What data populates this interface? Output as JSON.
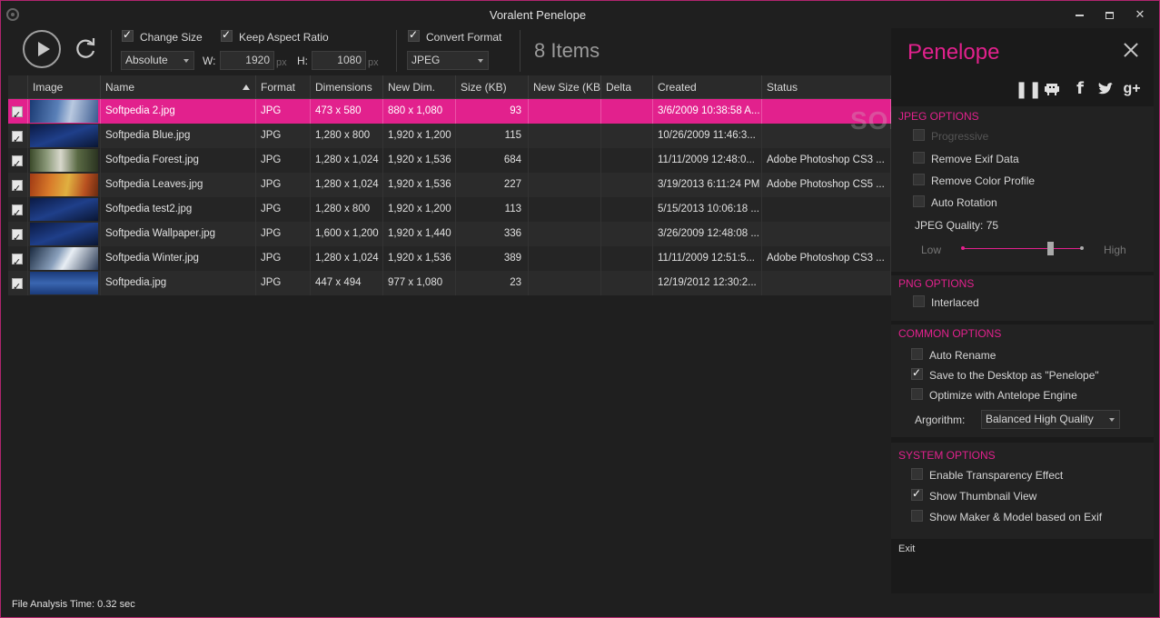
{
  "window": {
    "title": "Voralent Penelope"
  },
  "toolbar": {
    "change_size_label": "Change Size",
    "keep_aspect_label": "Keep Aspect Ratio",
    "convert_format_label": "Convert Format",
    "size_mode": "Absolute",
    "w_label": "W:",
    "h_label": "H:",
    "width_value": "1920",
    "height_value": "1080",
    "unit": "px",
    "format_value": "JPEG",
    "items_count": "8 Items"
  },
  "table": {
    "columns": [
      "Image",
      "Name",
      "Format",
      "Dimensions",
      "New Dim.",
      "Size (KB)",
      "New Size (KB)",
      "Delta",
      "Created",
      "Status"
    ],
    "rows": [
      {
        "name": "Softpedia 2.jpg",
        "format": "JPG",
        "dims": "473 x 580",
        "new_dims": "880 x 1,080",
        "size": "93",
        "new_size": "",
        "delta": "",
        "created": "3/6/2009 10:38:58 A...",
        "status": "",
        "thumb": "thumb-blue-light"
      },
      {
        "name": "Softpedia Blue.jpg",
        "format": "JPG",
        "dims": "1,280 x 800",
        "new_dims": "1,920 x 1,200",
        "size": "115",
        "new_size": "",
        "delta": "",
        "created": "10/26/2009 11:46:3...",
        "status": "",
        "thumb": "thumb-blue-dark"
      },
      {
        "name": "Softpedia Forest.jpg",
        "format": "JPG",
        "dims": "1,280 x 1,024",
        "new_dims": "1,920 x 1,536",
        "size": "684",
        "new_size": "",
        "delta": "",
        "created": "11/11/2009 12:48:0...",
        "status": "Adobe Photoshop CS3 ...",
        "thumb": "thumb-forest"
      },
      {
        "name": "Softpedia Leaves.jpg",
        "format": "JPG",
        "dims": "1,280 x 1,024",
        "new_dims": "1,920 x 1,536",
        "size": "227",
        "new_size": "",
        "delta": "",
        "created": "3/19/2013 6:11:24 PM",
        "status": "Adobe Photoshop CS5 ...",
        "thumb": "thumb-leaves"
      },
      {
        "name": "Softpedia test2.jpg",
        "format": "JPG",
        "dims": "1,280 x 800",
        "new_dims": "1,920 x 1,200",
        "size": "113",
        "new_size": "",
        "delta": "",
        "created": "5/15/2013 10:06:18 ...",
        "status": "",
        "thumb": "thumb-blue-dark"
      },
      {
        "name": "Softpedia Wallpaper.jpg",
        "format": "JPG",
        "dims": "1,600 x 1,200",
        "new_dims": "1,920 x 1,440",
        "size": "336",
        "new_size": "",
        "delta": "",
        "created": "3/26/2009 12:48:08 ...",
        "status": "",
        "thumb": "thumb-blue-dark"
      },
      {
        "name": "Softpedia Winter.jpg",
        "format": "JPG",
        "dims": "1,280 x 1,024",
        "new_dims": "1,920 x 1,536",
        "size": "389",
        "new_size": "",
        "delta": "",
        "created": "11/11/2009 12:51:5...",
        "status": "Adobe Photoshop CS3 ...",
        "thumb": "thumb-winter"
      },
      {
        "name": "Softpedia.jpg",
        "format": "JPG",
        "dims": "447 x 494",
        "new_dims": "977 x 1,080",
        "size": "23",
        "new_size": "",
        "delta": "",
        "created": "12/19/2012 12:30:2...",
        "status": "",
        "thumb": "thumb-logo"
      }
    ]
  },
  "panel": {
    "title": "Penelope",
    "jpeg_section": "JPEG OPTIONS",
    "progressive": "Progressive",
    "remove_exif": "Remove Exif Data",
    "remove_color_profile": "Remove Color Profile",
    "auto_rotation": "Auto Rotation",
    "jpeg_quality": "JPEG Quality: 75",
    "quality_value": 75,
    "low": "Low",
    "high": "High",
    "png_section": "PNG OPTIONS",
    "interlaced": "Interlaced",
    "common_section": "COMMON OPTIONS",
    "auto_rename": "Auto Rename",
    "save_desktop": "Save to the Desktop as \"Penelope\"",
    "optimize": "Optimize with Antelope Engine",
    "algorithm_label": "Argorithm:",
    "algorithm_value": "Balanced High Quality",
    "system_section": "SYSTEM OPTIONS",
    "transparency": "Enable Transparency Effect",
    "thumbnail_view": "Show Thumbnail View",
    "maker_model": "Show Maker & Model based on Exif",
    "exit": "Exit"
  },
  "watermark": "SOFTPEDIA",
  "status": {
    "analysis_time": "File Analysis Time: 0.32 sec"
  },
  "colors": {
    "accent": "#e2218d",
    "background": "#1f1f1f",
    "panel_bg": "#1a1a1a"
  }
}
